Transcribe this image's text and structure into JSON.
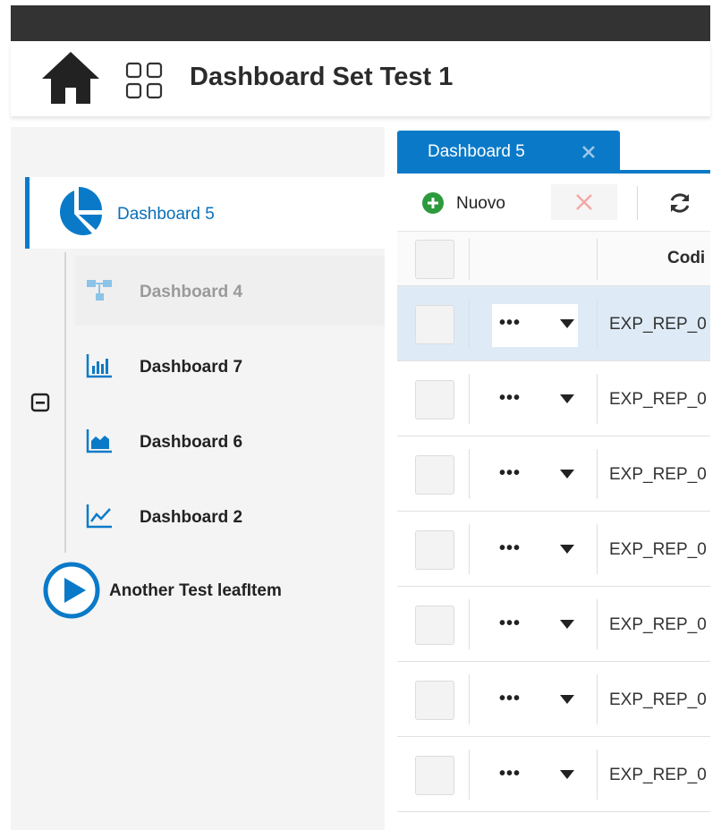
{
  "header": {
    "title": "Dashboard Set Test 1",
    "home_icon": "home-icon",
    "apps_icon": "apps-grid-icon"
  },
  "sidebar": {
    "active_item": {
      "label": "Dashboard 5",
      "icon": "pie-chart-icon"
    },
    "children": [
      {
        "label": "Dashboard 4",
        "icon": "hierarchy-icon",
        "state": "dimmed"
      },
      {
        "label": "Dashboard 7",
        "icon": "bar-chart-icon",
        "state": "normal"
      },
      {
        "label": "Dashboard 6",
        "icon": "area-chart-icon",
        "state": "normal"
      },
      {
        "label": "Dashboard 2",
        "icon": "line-chart-icon",
        "state": "normal"
      }
    ],
    "collapse_icon": "collapse-minus-icon",
    "leaf_item": {
      "label": "Another Test leafItem",
      "icon": "play-circle-icon"
    }
  },
  "tabs": [
    {
      "label": "Dashboard 5",
      "active": true,
      "close_icon": "close-icon"
    }
  ],
  "toolbar": {
    "new_label": "Nuovo",
    "new_icon": "plus-circle-icon",
    "delete_icon": "delete-x-icon",
    "refresh_icon": "refresh-icon"
  },
  "grid": {
    "columns": [
      "",
      "",
      "Codi"
    ],
    "rows": [
      {
        "menu": "•••",
        "code": "EXP_REP_0",
        "selected": true
      },
      {
        "menu": "•••",
        "code": "EXP_REP_0",
        "selected": false
      },
      {
        "menu": "•••",
        "code": "EXP_REP_0",
        "selected": false
      },
      {
        "menu": "•••",
        "code": "EXP_REP_0",
        "selected": false
      },
      {
        "menu": "•••",
        "code": "EXP_REP_0",
        "selected": false
      },
      {
        "menu": "•••",
        "code": "EXP_REP_0",
        "selected": false
      },
      {
        "menu": "•••",
        "code": "EXP_REP_0",
        "selected": false
      }
    ]
  },
  "colors": {
    "accent": "#0a7ac8",
    "top_bar": "#333333",
    "sidebar_bg": "#f4f4f4",
    "selected_row": "#deebf7",
    "new_button_green": "#2e9a3e",
    "delete_red": "#f4a6a6"
  }
}
